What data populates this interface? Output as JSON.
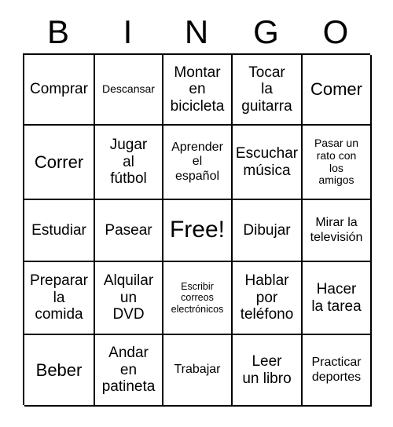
{
  "header": {
    "letters": [
      "B",
      "I",
      "N",
      "G",
      "O"
    ]
  },
  "grid": {
    "rows": 5,
    "columns": 5,
    "border_color": "#000000",
    "background_color": "#ffffff",
    "text_color": "#000000",
    "cells": [
      [
        {
          "text": "Comprar",
          "size": "md"
        },
        {
          "text": "Descansar",
          "size": "xs"
        },
        {
          "text": "Montar\nen\nbicicleta",
          "size": "md"
        },
        {
          "text": "Tocar\nla\nguitarra",
          "size": "md"
        },
        {
          "text": "Comer",
          "size": "lg"
        }
      ],
      [
        {
          "text": "Correr",
          "size": "lg"
        },
        {
          "text": "Jugar\nal\nfútbol",
          "size": "md"
        },
        {
          "text": "Aprender\nel\nespañol",
          "size": "sm"
        },
        {
          "text": "Escuchar\nmúsica",
          "size": "md"
        },
        {
          "text": "Pasar un\nrato con\nlos\namigos",
          "size": "xs"
        }
      ],
      [
        {
          "text": "Estudiar",
          "size": "md"
        },
        {
          "text": "Pasear",
          "size": "md"
        },
        {
          "text": "Free!",
          "size": "xl"
        },
        {
          "text": "Dibujar",
          "size": "md"
        },
        {
          "text": "Mirar la\ntelevisión",
          "size": "sm"
        }
      ],
      [
        {
          "text": "Preparar\nla\ncomida",
          "size": "md"
        },
        {
          "text": "Alquilar\nun\nDVD",
          "size": "md"
        },
        {
          "text": "Escribir\ncorreos\nelectrónicos",
          "size": "xxs"
        },
        {
          "text": "Hablar\npor\nteléfono",
          "size": "md"
        },
        {
          "text": "Hacer\nla tarea",
          "size": "md"
        }
      ],
      [
        {
          "text": "Beber",
          "size": "lg"
        },
        {
          "text": "Andar\nen\npatineta",
          "size": "md"
        },
        {
          "text": "Trabajar",
          "size": "sm"
        },
        {
          "text": "Leer\nun libro",
          "size": "md"
        },
        {
          "text": "Practicar\ndeportes",
          "size": "sm"
        }
      ]
    ]
  }
}
